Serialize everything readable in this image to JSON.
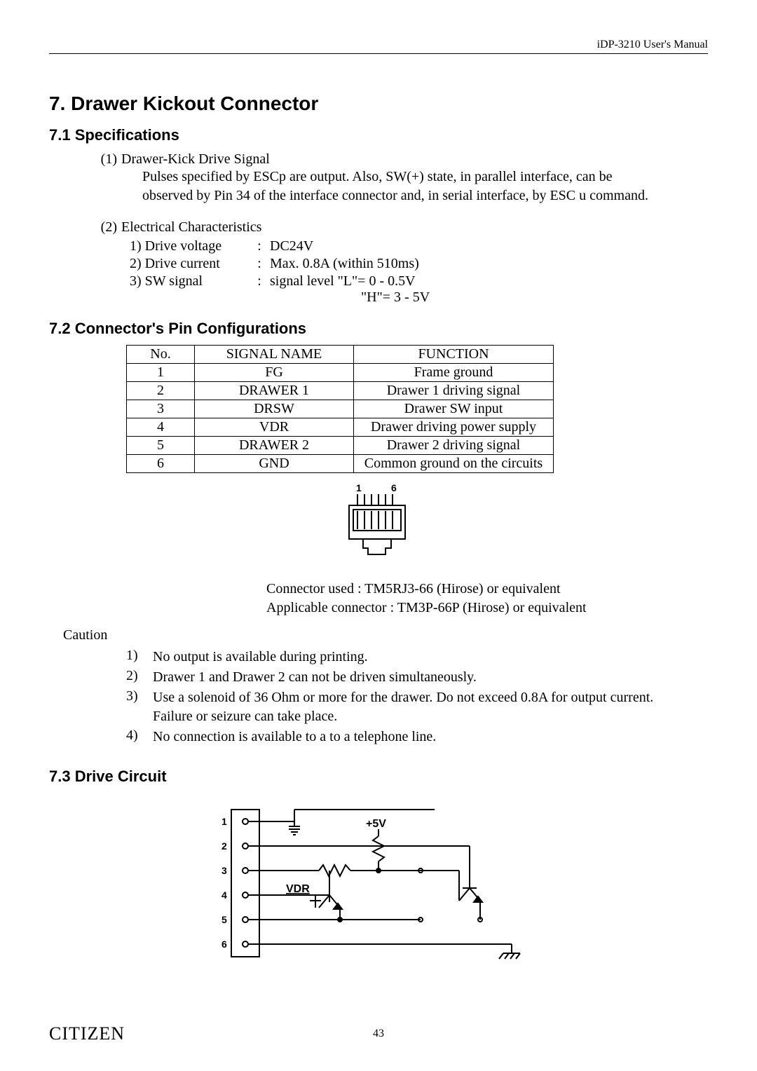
{
  "header": {
    "manual_title": "iDP-3210 User's Manual"
  },
  "section": {
    "number_title": "7. Drawer Kickout Connector"
  },
  "subsection_7_1": {
    "title": "7.1 Specifications"
  },
  "spec1": {
    "num": "(1)",
    "label": "Drawer-Kick Drive Signal",
    "line1": "Pulses specified by ESCp are output.    Also, SW(+) state, in parallel interface, can be",
    "line2": "observed by Pin 34 of the interface connector and, in serial interface, by ESC u command."
  },
  "spec2": {
    "num": "(2)",
    "label": "Electrical Characteristics",
    "rows": [
      {
        "label": "1) Drive voltage",
        "value": "DC24V"
      },
      {
        "label": "2) Drive current",
        "value": "Max. 0.8A (within 510ms)"
      },
      {
        "label": "3) SW signal",
        "value": "signal level    \"L\"= 0 - 0.5V",
        "value2": "\"H\"= 3 - 5V"
      }
    ]
  },
  "subsection_7_2": {
    "title": "7.2 Connector's Pin Configurations"
  },
  "pin_table": {
    "headers": [
      "No.",
      "SIGNAL NAME",
      "FUNCTION"
    ],
    "rows": [
      {
        "no": "1",
        "name": "FG",
        "fn": "Frame ground"
      },
      {
        "no": "2",
        "name": "DRAWER 1",
        "fn": "Drawer 1 driving signal"
      },
      {
        "no": "3",
        "name": "DRSW",
        "fn": "Drawer SW input"
      },
      {
        "no": "4",
        "name": "VDR",
        "fn": "Drawer driving power supply"
      },
      {
        "no": "5",
        "name": "DRAWER 2",
        "fn": "Drawer 2 driving signal"
      },
      {
        "no": "6",
        "name": "GND",
        "fn": "Common ground on the circuits"
      }
    ]
  },
  "connector_diagram": {
    "pin_left": "1",
    "pin_right": "6"
  },
  "conn_notes": {
    "line1": "Connector used          : TM5RJ3-66 (Hirose) or equivalent",
    "line2": "Applicable connector : TM3P-66P (Hirose) or equivalent"
  },
  "caution": {
    "label": "Caution",
    "items": [
      {
        "num": "1)",
        "text": "No output is available during printing."
      },
      {
        "num": "2)",
        "text": "Drawer 1 and Drawer 2 can not be driven simultaneously."
      },
      {
        "num": "3)",
        "text": "Use a solenoid of 36 Ohm or more for the drawer. Do not exceed 0.8A for output current.",
        "cont": "Failure or seizure can take place."
      },
      {
        "num": "4)",
        "text": "No connection is available to a to a telephone line."
      }
    ]
  },
  "subsection_7_3": {
    "title": "7.3 Drive Circuit"
  },
  "circuit": {
    "pins": [
      "1",
      "2",
      "3",
      "4",
      "5",
      "6"
    ],
    "label_5v": "+5V",
    "label_vdr": "VDR"
  },
  "footer": {
    "brand": "CITIZEN",
    "page_num": "43"
  }
}
